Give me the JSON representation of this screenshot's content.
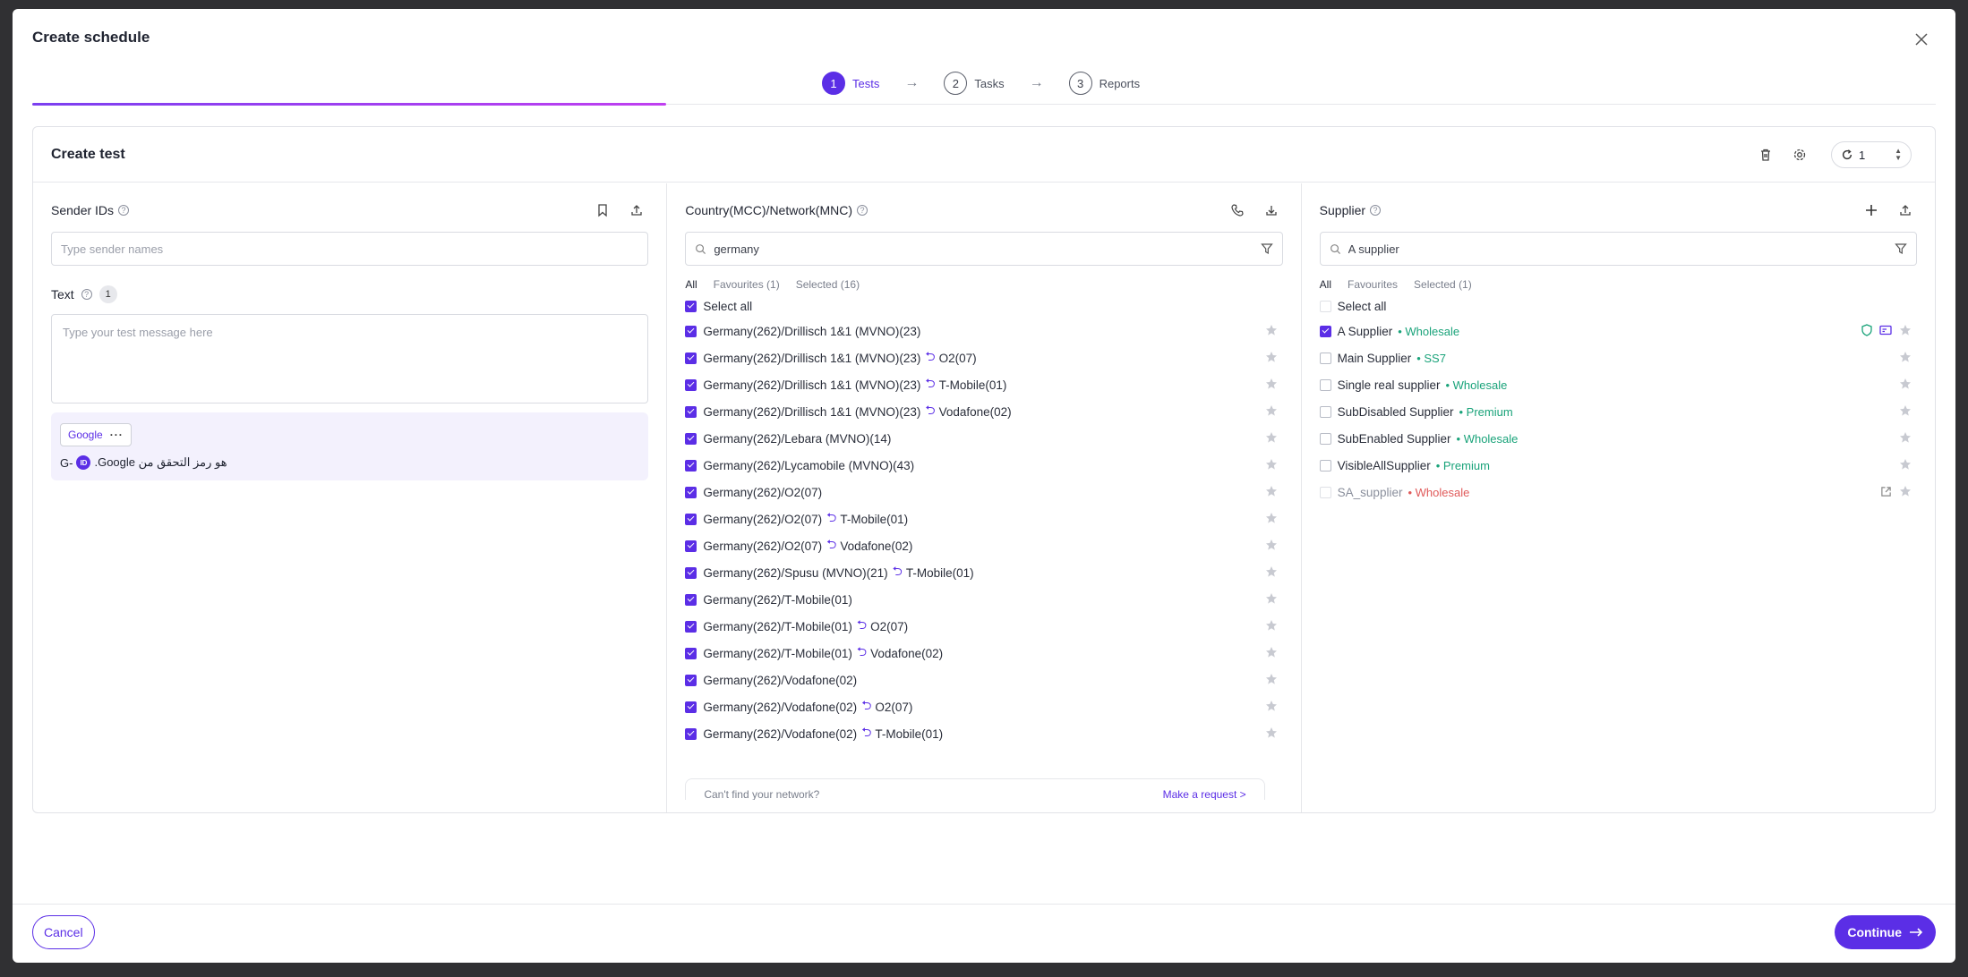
{
  "modal": {
    "title": "Create schedule"
  },
  "steps": [
    {
      "num": "1",
      "label": "Tests"
    },
    {
      "num": "2",
      "label": "Tasks"
    },
    {
      "num": "3",
      "label": "Reports"
    }
  ],
  "card": {
    "title": "Create test",
    "repeat_value": "1"
  },
  "sender": {
    "title": "Sender IDs",
    "placeholder": "Type sender names",
    "text_label": "Text",
    "text_count": "1",
    "message_placeholder": "Type your test message here",
    "preview_chip": "Google",
    "preview_prefix": "G-",
    "preview_badge": "ID",
    "preview_text": "هو رمز التحقق من Google."
  },
  "network": {
    "title": "Country(MCC)/Network(MNC)",
    "search_value": "germany",
    "tabs": [
      "All",
      "Favourites (1)",
      "Selected (16)"
    ],
    "select_all": "Select all",
    "items": [
      {
        "name": "Germany(262)/Drillisch 1&1 (MVNO)(23)",
        "via": ""
      },
      {
        "name": "Germany(262)/Drillisch 1&1 (MVNO)(23)",
        "via": "O2(07)"
      },
      {
        "name": "Germany(262)/Drillisch 1&1 (MVNO)(23)",
        "via": "T-Mobile(01)"
      },
      {
        "name": "Germany(262)/Drillisch 1&1 (MVNO)(23)",
        "via": "Vodafone(02)"
      },
      {
        "name": "Germany(262)/Lebara (MVNO)(14)",
        "via": ""
      },
      {
        "name": "Germany(262)/Lycamobile (MVNO)(43)",
        "via": ""
      },
      {
        "name": "Germany(262)/O2(07)",
        "via": ""
      },
      {
        "name": "Germany(262)/O2(07)",
        "via": "T-Mobile(01)"
      },
      {
        "name": "Germany(262)/O2(07)",
        "via": "Vodafone(02)"
      },
      {
        "name": "Germany(262)/Spusu (MVNO)(21)",
        "via": "T-Mobile(01)"
      },
      {
        "name": "Germany(262)/T-Mobile(01)",
        "via": ""
      },
      {
        "name": "Germany(262)/T-Mobile(01)",
        "via": "O2(07)"
      },
      {
        "name": "Germany(262)/T-Mobile(01)",
        "via": "Vodafone(02)"
      },
      {
        "name": "Germany(262)/Vodafone(02)",
        "via": ""
      },
      {
        "name": "Germany(262)/Vodafone(02)",
        "via": "O2(07)"
      },
      {
        "name": "Germany(262)/Vodafone(02)",
        "via": "T-Mobile(01)"
      }
    ],
    "cant_find": "Can't find your network?",
    "make_request": "Make a request >"
  },
  "supplier": {
    "title": "Supplier",
    "search_value": "A supplier",
    "tabs": [
      "All",
      "Favourites",
      "Selected (1)"
    ],
    "select_all": "Select all",
    "items": [
      {
        "name": "A Supplier",
        "tag": "Wholesale",
        "tag_color": "#1aa37a",
        "checked": true,
        "disabled": false
      },
      {
        "name": "Main Supplier",
        "tag": "SS7",
        "tag_color": "#1aa37a",
        "checked": false,
        "disabled": false
      },
      {
        "name": "Single real supplier",
        "tag": "Wholesale",
        "tag_color": "#1aa37a",
        "checked": false,
        "disabled": false
      },
      {
        "name": "SubDisabled Supplier",
        "tag": "Premium",
        "tag_color": "#1aa37a",
        "checked": false,
        "disabled": false
      },
      {
        "name": "SubEnabled Supplier",
        "tag": "Wholesale",
        "tag_color": "#1aa37a",
        "checked": false,
        "disabled": false
      },
      {
        "name": "VisibleAllSupplier",
        "tag": "Premium",
        "tag_color": "#1aa37a",
        "checked": false,
        "disabled": false
      },
      {
        "name": "SA_supplier",
        "tag": "Wholesale",
        "tag_color": "#e05a5a",
        "checked": false,
        "disabled": true
      }
    ]
  },
  "footer": {
    "cancel": "Cancel",
    "continue": "Continue"
  },
  "colors": {
    "accent": "#5b2ee6",
    "green": "#1aa37a",
    "red": "#e05a5a"
  }
}
